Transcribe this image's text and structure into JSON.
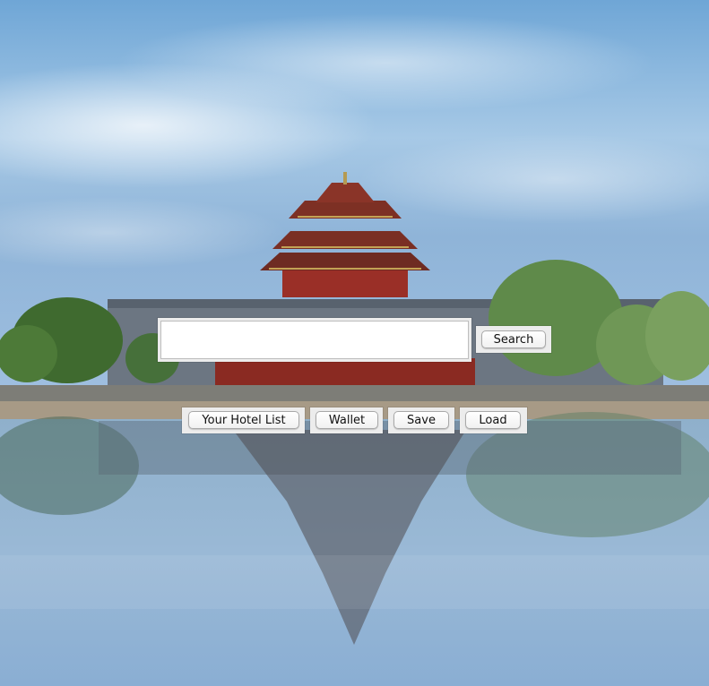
{
  "search": {
    "value": "",
    "placeholder": "",
    "button_label": "Search"
  },
  "actions": {
    "hotel_list_label": "Your Hotel List",
    "wallet_label": "Wallet",
    "save_label": "Save",
    "load_label": "Load"
  },
  "background": {
    "sky_top": "#7fb4dc",
    "sky_mid": "#a9cbe6",
    "water": "#8fb1cf",
    "roof": "#7a2b20",
    "wall": "#5f6b78",
    "trees": "#4d6e3a"
  }
}
